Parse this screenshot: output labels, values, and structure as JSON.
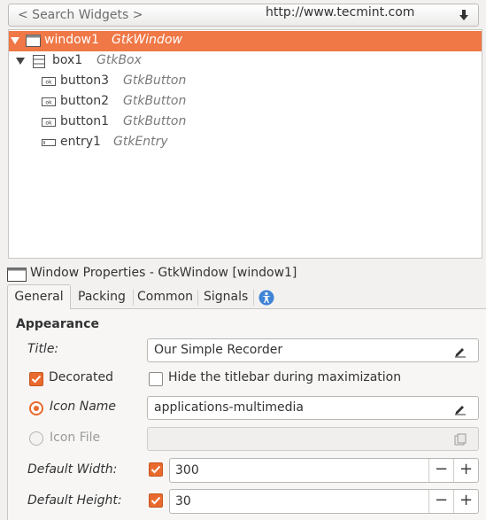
{
  "search": {
    "placeholder": "< Search Widgets >",
    "watermark": "http://www.tecmint.com"
  },
  "tree": [
    {
      "name": "window1",
      "type": "GtkWindow",
      "selected": true,
      "expander": "open",
      "icon": "window-icon"
    },
    {
      "name": "box1",
      "type": "GtkBox",
      "expander": "open",
      "icon": "box-icon"
    },
    {
      "name": "button3",
      "type": "GtkButton",
      "icon": "button-icon"
    },
    {
      "name": "button2",
      "type": "GtkButton",
      "icon": "button-icon"
    },
    {
      "name": "button1",
      "type": "GtkButton",
      "icon": "button-icon"
    },
    {
      "name": "entry1",
      "type": "GtkEntry",
      "icon": "entry-icon"
    }
  ],
  "properties": {
    "header": "Window Properties - GtkWindow [window1]"
  },
  "tabs": [
    "General",
    "Packing",
    "Common",
    "Signals"
  ],
  "active_tab": "General",
  "section": "Appearance",
  "form": {
    "title_label": "Title:",
    "title_value": "Our Simple Recorder",
    "decorated_label": "Decorated",
    "hide_titlebar_label": "Hide the titlebar during maximization",
    "icon_name_label": "Icon Name",
    "icon_name_value": "applications-multimedia",
    "icon_file_label": "Icon File",
    "icon_file_value": "",
    "default_width_label": "Default Width:",
    "default_width_value": "300",
    "default_height_label": "Default Height:",
    "default_height_value": "30"
  },
  "colors": {
    "accent": "#f07746",
    "checkbox": "#e96a2e"
  }
}
